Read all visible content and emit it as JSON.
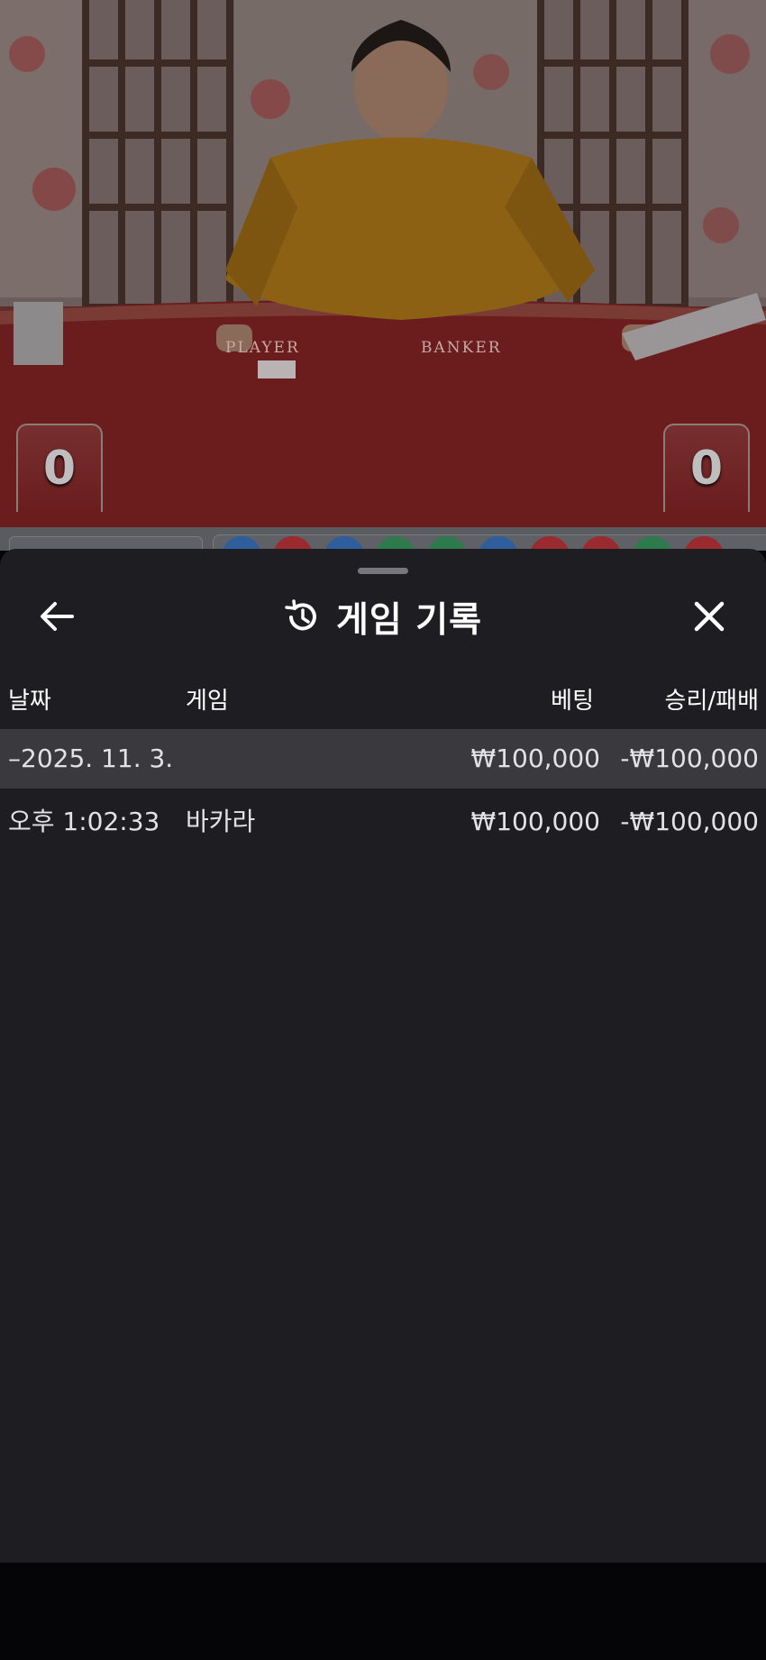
{
  "video": {
    "player_label": "PLAYER",
    "banker_label": "BANKER",
    "player_score": "0",
    "banker_score": "0"
  },
  "sheet": {
    "title": "게임 기록",
    "icons": {
      "back": "arrow-left-icon",
      "title": "history-icon",
      "close": "close-icon"
    },
    "columns": {
      "date": "날짜",
      "game": "게임",
      "bet": "베팅",
      "result": "승리/패배"
    },
    "date_group": {
      "date": "–2025. 11. 3.",
      "bet_total": "₩100,000",
      "result_total": "-₩100,000"
    },
    "rows": [
      {
        "time": "오후 1:02:33",
        "game": "바카라",
        "bet": "₩100,000",
        "result": "-₩100,000"
      }
    ]
  },
  "colors": {
    "sheet_bg": "#1e1d22",
    "highlight_row": "#3a393e",
    "text": "#ffffff",
    "table_felt": "#6a1b1c"
  }
}
